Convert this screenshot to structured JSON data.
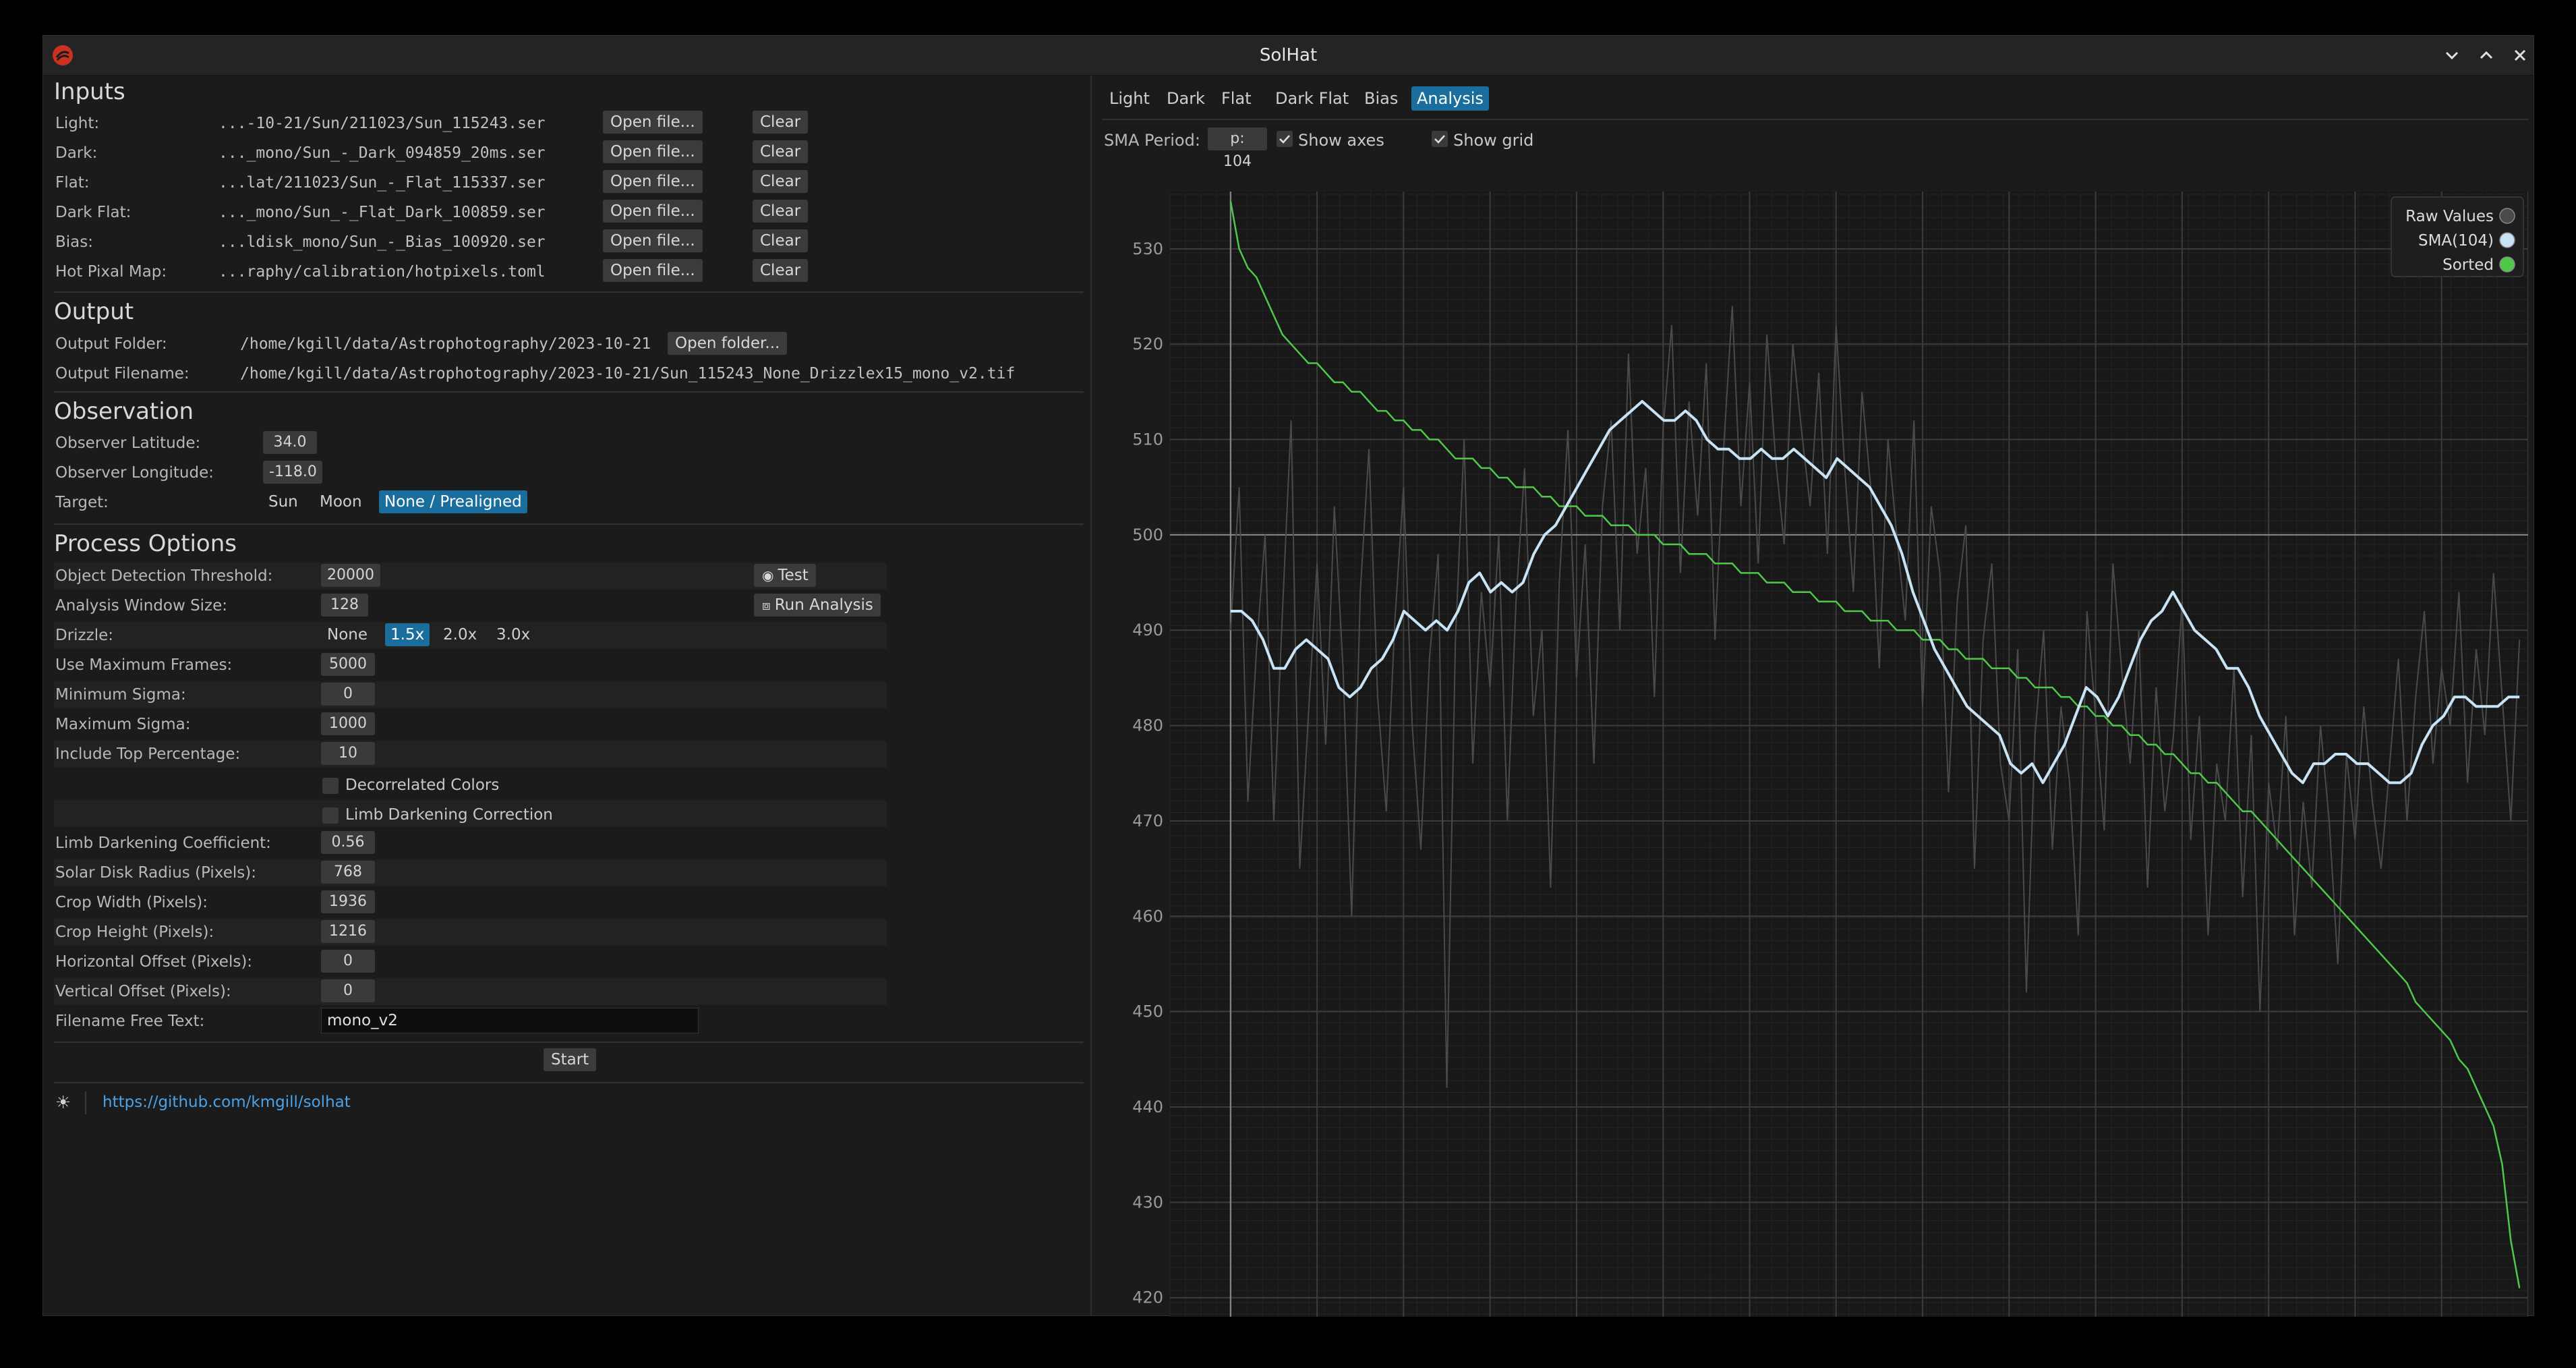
{
  "window": {
    "title": "SolHat"
  },
  "inputs": {
    "title": "Inputs",
    "rows": [
      {
        "label": "Light:",
        "path": "...-10-21/Sun/211023/Sun_115243.ser",
        "open": "Open file...",
        "clear": "Clear"
      },
      {
        "label": "Dark:",
        "path": "..._mono/Sun_-_Dark_094859_20ms.ser",
        "open": "Open file...",
        "clear": "Clear"
      },
      {
        "label": "Flat:",
        "path": "...lat/211023/Sun_-_Flat_115337.ser",
        "open": "Open file...",
        "clear": "Clear"
      },
      {
        "label": "Dark Flat:",
        "path": "..._mono/Sun_-_Flat_Dark_100859.ser",
        "open": "Open file...",
        "clear": "Clear"
      },
      {
        "label": "Bias:",
        "path": "...ldisk_mono/Sun_-_Bias_100920.ser",
        "open": "Open file...",
        "clear": "Clear"
      },
      {
        "label": "Hot Pixal Map:",
        "path": "...raphy/calibration/hotpixels.toml",
        "open": "Open file...",
        "clear": "Clear"
      }
    ]
  },
  "output": {
    "title": "Output",
    "folder_label": "Output Folder:",
    "folder_value": "/home/kgill/data/Astrophotography/2023-10-21",
    "open_folder": "Open folder...",
    "filename_label": "Output Filename:",
    "filename_value": "/home/kgill/data/Astrophotography/2023-10-21/Sun_115243_None_Drizzlex15_mono_v2.tif"
  },
  "observation": {
    "title": "Observation",
    "lat_label": "Observer Latitude:",
    "lat_value": "34.0",
    "lon_label": "Observer Longitude:",
    "lon_value": "-118.0",
    "target_label": "Target:",
    "targets": [
      "Sun",
      "Moon",
      "None / Prealigned"
    ],
    "selected_target": "None / Prealigned"
  },
  "process": {
    "title": "Process Options",
    "odt_label": "Object Detection Threshold:",
    "odt_value": "20000",
    "test_button": "Test",
    "aws_label": "Analysis Window Size:",
    "aws_value": "128",
    "run_analysis_button": "Run Analysis",
    "drizzle_label": "Drizzle:",
    "drizzle_options": [
      "None",
      "1.5x",
      "2.0x",
      "3.0x"
    ],
    "drizzle_selected": "1.5x",
    "rows": [
      {
        "label": "Use Maximum Frames:",
        "value": "5000"
      },
      {
        "label": "Minimum Sigma:",
        "value": "0"
      },
      {
        "label": "Maximum Sigma:",
        "value": "1000"
      },
      {
        "label": "Include Top Percentage:",
        "value": "10"
      }
    ],
    "decorrelated_label": "Decorrelated Colors",
    "decorrelated_checked": false,
    "limb_correction_label": "Limb Darkening Correction",
    "limb_correction_checked": false,
    "rows2": [
      {
        "label": "Limb Darkening Coefficient:",
        "value": "0.56"
      },
      {
        "label": "Solar Disk Radius (Pixels):",
        "value": "768"
      },
      {
        "label": "Crop Width (Pixels):",
        "value": "1936"
      },
      {
        "label": "Crop Height (Pixels):",
        "value": "1216"
      },
      {
        "label": "Horizontal Offset (Pixels):",
        "value": "0"
      },
      {
        "label": "Vertical Offset (Pixels):",
        "value": "0"
      }
    ],
    "free_text_label": "Filename Free Text:",
    "free_text_value": "mono_v2",
    "start_button": "Start"
  },
  "footer": {
    "theme_icon": "sun-icon",
    "link": "https://github.com/kmgill/solhat"
  },
  "tabs": [
    "Light",
    "Dark",
    "Flat",
    "Dark Flat",
    "Bias",
    "Analysis"
  ],
  "active_tab": "Analysis",
  "analysis_toolbar": {
    "sma_label": "SMA Period:",
    "sma_value": "p: 104",
    "show_axes_label": "Show axes",
    "show_axes_checked": true,
    "show_grid_label": "Show grid",
    "show_grid_checked": true
  },
  "colors": {
    "accent": "#1a6e9e",
    "raw": "#4a4a4a",
    "sma": "#c8e4f4",
    "sorted": "#4fc84a",
    "link": "#4aa3e8"
  },
  "chart_data": {
    "type": "line",
    "title": "",
    "xlabel": "",
    "ylabel": "",
    "ylim": [
      418,
      536
    ],
    "xlim": [
      -7,
      150
    ],
    "y_ticks": [
      420,
      430,
      440,
      450,
      460,
      470,
      480,
      490,
      500,
      510,
      520,
      530
    ],
    "grid": true,
    "axes_shown": true,
    "legend_position": "top-right",
    "series": [
      {
        "name": "Raw Values",
        "color": "#4a4a4a",
        "values": [
          490,
          505,
          472,
          488,
          500,
          470,
          492,
          512,
          465,
          481,
          497,
          478,
          503,
          486,
          460,
          494,
          509,
          483,
          471,
          491,
          505,
          480,
          467,
          487,
          498,
          442,
          489,
          510,
          476,
          494,
          484,
          500,
          470,
          493,
          507,
          481,
          490,
          463,
          495,
          511,
          485,
          499,
          476,
          503,
          512,
          490,
          519,
          498,
          507,
          483,
          511,
          522,
          496,
          514,
          502,
          518,
          489,
          509,
          524,
          503,
          516,
          497,
          521,
          508,
          499,
          520,
          511,
          503,
          517,
          498,
          522,
          507,
          494,
          515,
          505,
          486,
          510,
          500,
          491,
          512,
          482,
          503,
          496,
          473,
          493,
          501,
          465,
          489,
          497,
          476,
          470,
          488,
          452,
          479,
          490,
          467,
          482,
          474,
          458,
          492,
          481,
          469,
          497,
          486,
          476,
          490,
          463,
          484,
          471,
          479,
          493,
          468,
          481,
          458,
          476,
          470,
          486,
          462,
          479,
          450,
          474,
          467,
          481,
          458,
          472,
          463,
          480,
          470,
          455,
          477,
          468,
          482,
          472,
          465,
          476,
          487,
          470,
          483,
          492,
          476,
          486,
          480,
          494,
          474,
          488,
          479,
          496,
          483,
          470,
          489
        ]
      },
      {
        "name": "SMA(104)",
        "color": "#c8e4f4",
        "values": [
          492,
          492,
          491,
          489,
          486,
          486,
          488,
          489,
          488,
          487,
          484,
          483,
          484,
          486,
          487,
          489,
          492,
          491,
          490,
          491,
          490,
          492,
          495,
          496,
          494,
          495,
          494,
          495,
          498,
          500,
          501,
          503,
          505,
          507,
          509,
          511,
          512,
          513,
          514,
          513,
          512,
          512,
          513,
          512,
          510,
          509,
          509,
          508,
          508,
          509,
          508,
          508,
          509,
          508,
          507,
          506,
          508,
          507,
          506,
          505,
          503,
          501,
          498,
          494,
          491,
          488,
          486,
          484,
          482,
          481,
          480,
          479,
          476,
          475,
          476,
          474,
          476,
          478,
          481,
          484,
          483,
          481,
          483,
          486,
          489,
          491,
          492,
          494,
          492,
          490,
          489,
          488,
          486,
          486,
          484,
          481,
          479,
          477,
          475,
          474,
          476,
          476,
          477,
          477,
          476,
          476,
          475,
          474,
          474,
          475,
          478,
          480,
          481,
          483,
          483,
          482,
          482,
          482,
          483,
          483
        ]
      },
      {
        "name": "Sorted",
        "color": "#4fc84a",
        "values": [
          535,
          530,
          528,
          527,
          525,
          523,
          521,
          520,
          519,
          518,
          518,
          517,
          516,
          516,
          515,
          515,
          514,
          513,
          513,
          512,
          512,
          511,
          511,
          510,
          510,
          509,
          508,
          508,
          508,
          507,
          507,
          506,
          506,
          505,
          505,
          505,
          504,
          504,
          503,
          503,
          503,
          502,
          502,
          502,
          501,
          501,
          501,
          500,
          500,
          500,
          499,
          499,
          499,
          498,
          498,
          498,
          497,
          497,
          497,
          496,
          496,
          496,
          495,
          495,
          495,
          494,
          494,
          494,
          493,
          493,
          493,
          492,
          492,
          492,
          491,
          491,
          491,
          490,
          490,
          490,
          489,
          489,
          489,
          488,
          488,
          487,
          487,
          487,
          486,
          486,
          486,
          485,
          485,
          484,
          484,
          484,
          483,
          483,
          482,
          482,
          481,
          481,
          480,
          480,
          479,
          479,
          478,
          478,
          477,
          477,
          476,
          475,
          475,
          474,
          474,
          473,
          472,
          471,
          471,
          470,
          469,
          468,
          467,
          466,
          465,
          464,
          463,
          462,
          461,
          460,
          459,
          458,
          457,
          456,
          455,
          454,
          453,
          451,
          450,
          449,
          448,
          447,
          445,
          444,
          442,
          440,
          438,
          434,
          426,
          421
        ]
      }
    ]
  }
}
